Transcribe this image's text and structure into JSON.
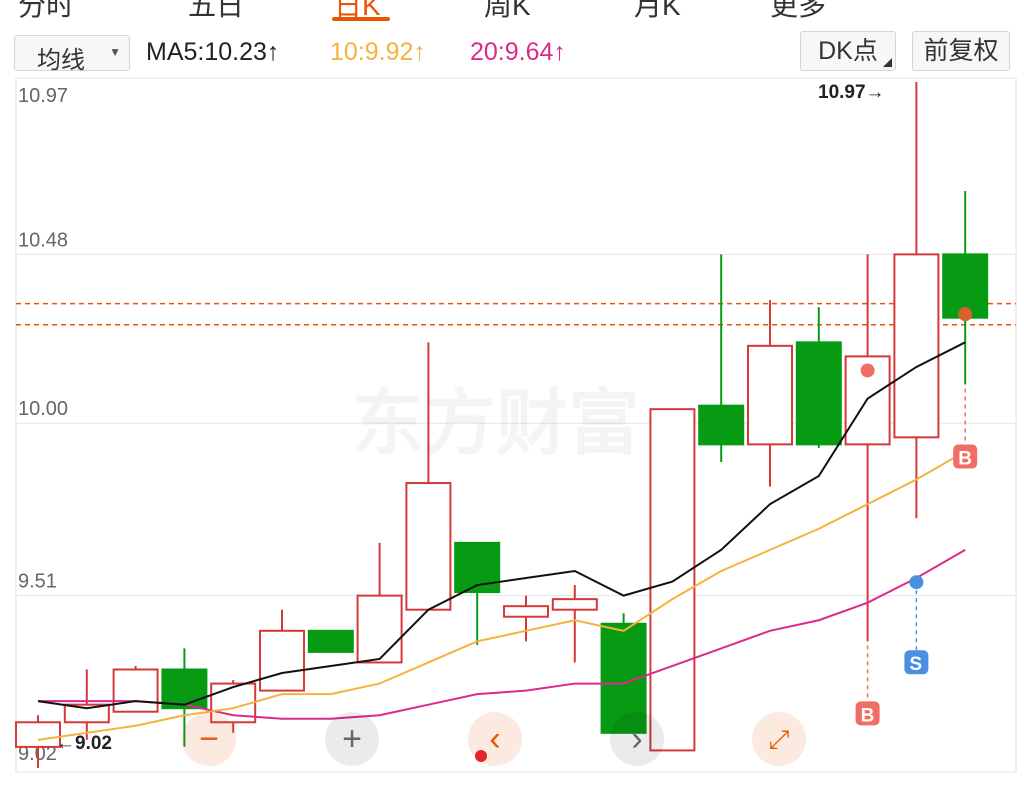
{
  "tabs": [
    "分时",
    "五日",
    "日K",
    "周K",
    "月K",
    "更多"
  ],
  "toolbar": {
    "indicator_select": "均线",
    "ma5": "MA5:10.23↑",
    "ma10": "10:9.92↑",
    "ma20": "20:9.64↑",
    "dk_button": "DK点",
    "restore_button": "前复权"
  },
  "colors": {
    "accent": "#ea5504",
    "up": "#d4393a",
    "down": "#079b14",
    "ma5": "#111111",
    "ma10": "#f5b23c",
    "ma20": "#dc2a8a",
    "buy_marker": "#f26d65",
    "sell_marker": "#4a90e2"
  },
  "watermark": "东方财富",
  "markers": {
    "high_label": "10.97→",
    "low_label": "←9.02",
    "buy": "B",
    "sell": "S"
  },
  "chart_data": {
    "type": "candlestick",
    "y_ticks": [
      "10.97",
      "10.48",
      "10.00",
      "9.51",
      "9.02"
    ],
    "ylim": [
      9.02,
      10.97
    ],
    "candles": [
      {
        "open": 9.08,
        "close": 9.15,
        "high": 9.17,
        "low": 9.02
      },
      {
        "open": 9.15,
        "close": 9.2,
        "high": 9.3,
        "low": 9.1
      },
      {
        "open": 9.18,
        "close": 9.3,
        "high": 9.31,
        "low": 9.18
      },
      {
        "open": 9.3,
        "close": 9.19,
        "high": 9.36,
        "low": 9.08
      },
      {
        "open": 9.15,
        "close": 9.26,
        "high": 9.27,
        "low": 9.12
      },
      {
        "open": 9.24,
        "close": 9.41,
        "high": 9.47,
        "low": 9.24
      },
      {
        "open": 9.41,
        "close": 9.35,
        "high": 9.41,
        "low": 9.35
      },
      {
        "open": 9.32,
        "close": 9.51,
        "high": 9.66,
        "low": 9.32
      },
      {
        "open": 9.47,
        "close": 9.83,
        "high": 10.23,
        "low": 9.47
      },
      {
        "open": 9.66,
        "close": 9.52,
        "high": 9.66,
        "low": 9.37
      },
      {
        "open": 9.45,
        "close": 9.48,
        "high": 9.51,
        "low": 9.38
      },
      {
        "open": 9.47,
        "close": 9.5,
        "high": 9.54,
        "low": 9.32
      },
      {
        "open": 9.43,
        "close": 9.12,
        "high": 9.46,
        "low": 9.12
      },
      {
        "open": 9.07,
        "close": 10.04,
        "high": 10.04,
        "low": 9.07
      },
      {
        "open": 10.05,
        "close": 9.94,
        "high": 10.48,
        "low": 9.89
      },
      {
        "open": 9.94,
        "close": 10.22,
        "high": 10.35,
        "low": 9.82
      },
      {
        "open": 10.23,
        "close": 9.94,
        "high": 10.33,
        "low": 9.93
      },
      {
        "open": 9.94,
        "close": 10.19,
        "high": 10.48,
        "low": 9.38
      },
      {
        "open": 9.96,
        "close": 10.48,
        "high": 10.97,
        "low": 9.73
      },
      {
        "open": 10.48,
        "close": 10.3,
        "high": 10.66,
        "low": 10.11
      }
    ],
    "ma5": [
      9.21,
      9.19,
      9.21,
      9.2,
      9.25,
      9.29,
      9.31,
      9.33,
      9.47,
      9.54,
      9.56,
      9.58,
      9.51,
      9.55,
      9.64,
      9.77,
      9.85,
      10.07,
      10.16,
      10.23
    ],
    "ma10": [
      9.1,
      9.12,
      9.14,
      9.17,
      9.19,
      9.23,
      9.23,
      9.26,
      9.32,
      9.38,
      9.41,
      9.44,
      9.41,
      9.5,
      9.58,
      9.64,
      9.7,
      9.77,
      9.84,
      9.92
    ],
    "ma20": [
      9.21,
      9.21,
      9.21,
      9.2,
      9.17,
      9.16,
      9.16,
      9.17,
      9.2,
      9.23,
      9.24,
      9.26,
      9.26,
      9.31,
      9.36,
      9.41,
      9.44,
      9.49,
      9.56,
      9.64
    ],
    "reference_lines": [
      10.34,
      10.28
    ],
    "buy_signals": [
      17,
      19
    ],
    "sell_signals": [
      18
    ]
  },
  "controls": [
    "zoom-out",
    "zoom-in",
    "scroll-left",
    "scroll-right",
    "fullscreen"
  ]
}
